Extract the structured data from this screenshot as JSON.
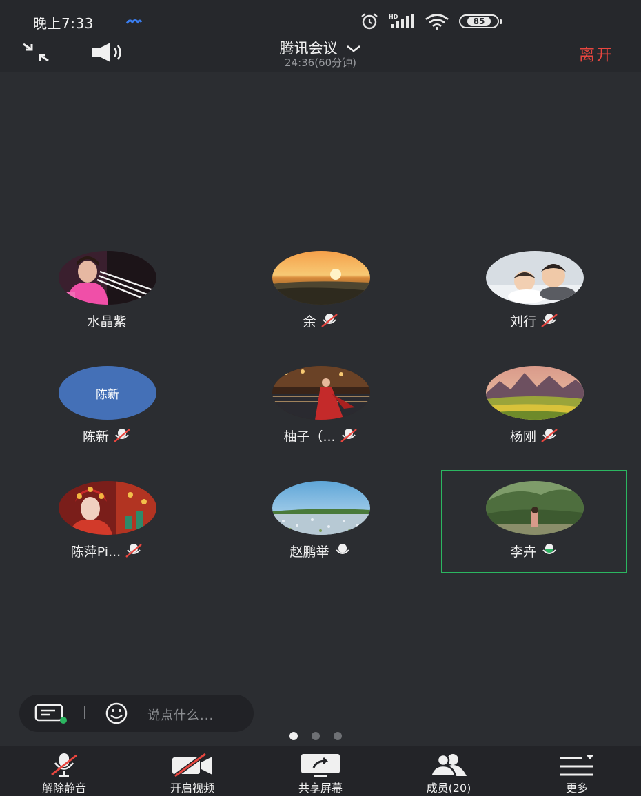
{
  "status_bar": {
    "time": "晚上7:33",
    "battery": "85",
    "icons": [
      "alarm-icon",
      "hd-signal-icon",
      "wifi-icon",
      "battery-icon"
    ]
  },
  "header": {
    "title": "腾讯会议",
    "duration": "24:36(60分钟)",
    "leave_label": "离开"
  },
  "participants": [
    {
      "name": "水晶紫",
      "muted": null,
      "avatar": "photo"
    },
    {
      "name": "余",
      "muted": true,
      "avatar": "photo"
    },
    {
      "name": "刘行",
      "muted": true,
      "avatar": "photo"
    },
    {
      "name": "陈新",
      "muted": true,
      "avatar": "text",
      "avatar_text": "陈新"
    },
    {
      "name": "柚子（...",
      "muted": true,
      "avatar": "photo"
    },
    {
      "name": "杨刚",
      "muted": true,
      "avatar": "photo"
    },
    {
      "name": "陈萍Pi...",
      "muted": true,
      "avatar": "photo"
    },
    {
      "name": "赵鹏举",
      "muted": false,
      "avatar": "photo"
    },
    {
      "name": "李卉",
      "muted": false,
      "speaking": true,
      "avatar": "photo"
    }
  ],
  "chat": {
    "placeholder": "说点什么..."
  },
  "pager": {
    "pages": 3,
    "current": 1
  },
  "toolbar": {
    "unmute": "解除静音",
    "video": "开启视频",
    "share": "共享屏幕",
    "members": "成员(20)",
    "more": "更多"
  },
  "colors": {
    "background": "#2b2d31",
    "leave": "#e8463f",
    "active_speaker": "#2bb660",
    "text_avatar": "#4470b7"
  }
}
